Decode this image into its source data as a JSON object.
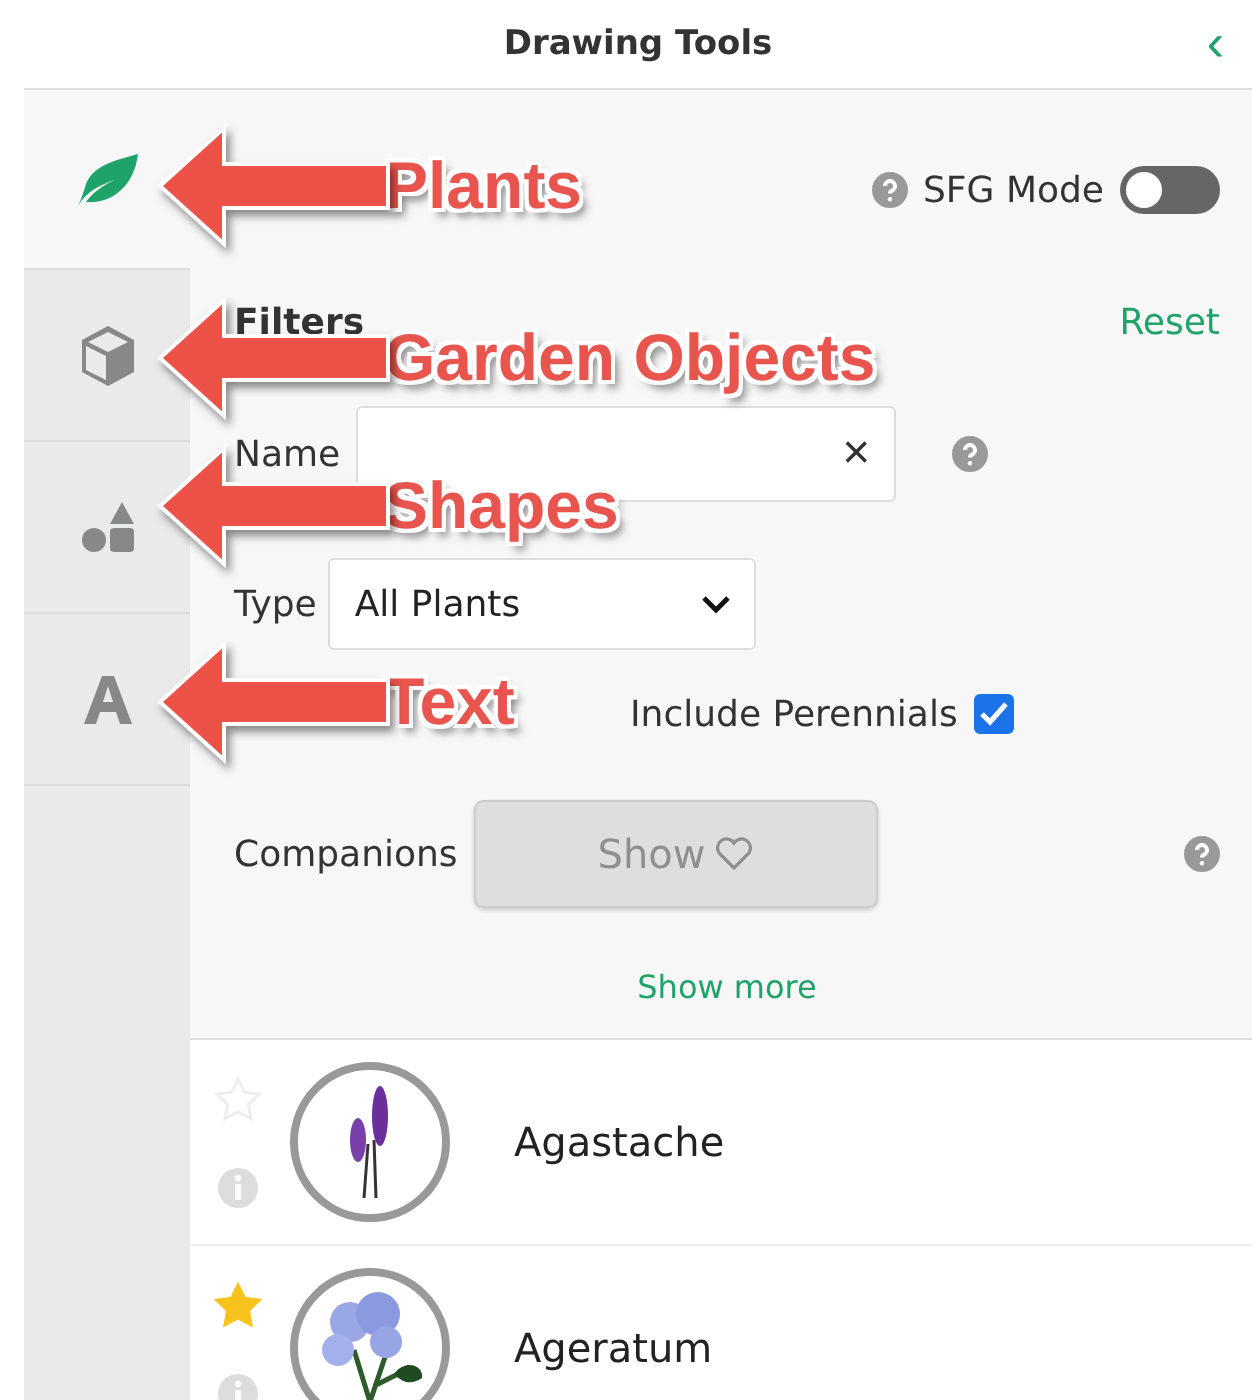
{
  "header": {
    "title": "Drawing Tools",
    "collapse_glyph": "‹"
  },
  "tabs": [
    {
      "kind": "leaf",
      "selected": true
    },
    {
      "kind": "cube",
      "selected": false
    },
    {
      "kind": "shapes",
      "selected": false
    },
    {
      "kind": "letter",
      "selected": false
    }
  ],
  "sfg_mode": {
    "label": "SFG Mode",
    "on": false
  },
  "filters": {
    "title": "Filters",
    "reset": "Reset",
    "name_label": "Name",
    "clear_glyph": "×",
    "type_label": "Type",
    "type_value": "All Plants",
    "include_perennials": {
      "label": "Include Perennials",
      "checked": true
    },
    "companions_label": "Companions",
    "companions_button": {
      "label": "Show",
      "disabled": true
    },
    "show_more": "Show more"
  },
  "plants": [
    {
      "name": "Agastache",
      "favorite": false,
      "kind": "spike"
    },
    {
      "name": "Ageratum",
      "favorite": true,
      "kind": "cluster"
    }
  ],
  "annotations": [
    {
      "label": "Plants"
    },
    {
      "label": "Garden Objects"
    },
    {
      "label": "Shapes"
    },
    {
      "label": "Text"
    }
  ]
}
